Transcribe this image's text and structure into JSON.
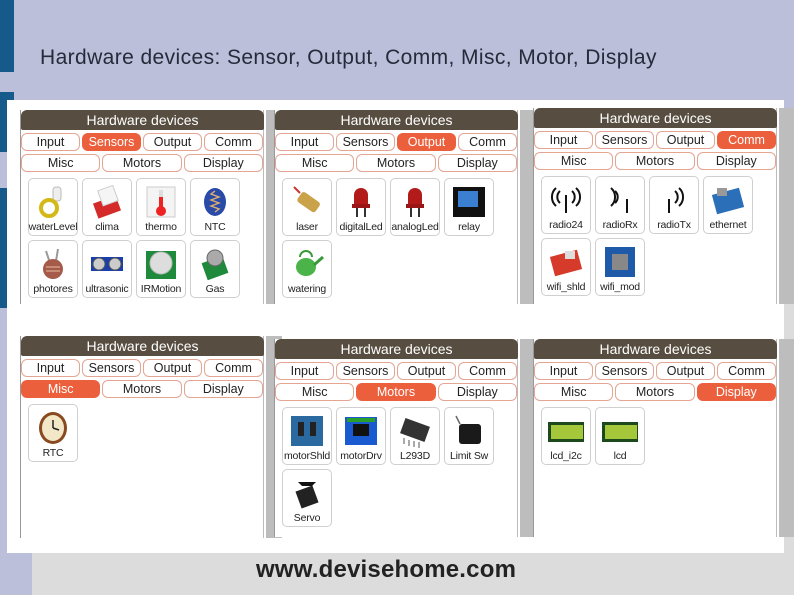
{
  "slide": {
    "title": "Hardware devices: Sensor, Output, Comm, Misc, Motor, Display",
    "footer": "www.devisehome.com"
  },
  "panel_header": "Hardware devices",
  "tabs_row1": [
    "Input",
    "Sensors",
    "Output",
    "Comm"
  ],
  "tabs_row2": [
    "Misc",
    "Motors",
    "Display"
  ],
  "colors": {
    "accent": "#ec5f3d",
    "header": "#574d40",
    "tab_border": "#e4a593"
  },
  "panels": [
    {
      "id": "sensors",
      "active": "Sensors",
      "devices": [
        {
          "label": "waterLevel",
          "icon": "water-level-sensor-icon"
        },
        {
          "label": "clima",
          "icon": "climate-sensor-icon"
        },
        {
          "label": "thermo",
          "icon": "thermometer-icon"
        },
        {
          "label": "NTC",
          "icon": "ntc-thermistor-icon"
        },
        {
          "label": "photores",
          "icon": "photoresistor-icon"
        },
        {
          "label": "ultrasonic",
          "icon": "ultrasonic-sensor-icon"
        },
        {
          "label": "IRMotion",
          "icon": "pir-motion-sensor-icon"
        },
        {
          "label": "Gas",
          "icon": "gas-sensor-icon"
        }
      ]
    },
    {
      "id": "output",
      "active": "Output",
      "devices": [
        {
          "label": "laser",
          "icon": "laser-icon"
        },
        {
          "label": "digitalLed",
          "icon": "led-icon"
        },
        {
          "label": "analogLed",
          "icon": "led-icon"
        },
        {
          "label": "relay",
          "icon": "relay-icon"
        },
        {
          "label": "watering",
          "icon": "watering-can-icon"
        }
      ]
    },
    {
      "id": "comm",
      "active": "Comm",
      "devices": [
        {
          "label": "radio24",
          "icon": "radio-antenna-icon"
        },
        {
          "label": "radioRx",
          "icon": "radio-receive-icon"
        },
        {
          "label": "radioTx",
          "icon": "radio-transmit-icon"
        },
        {
          "label": "ethernet",
          "icon": "ethernet-shield-icon"
        },
        {
          "label": "wifi_shld",
          "icon": "wifi-shield-icon"
        },
        {
          "label": "wifi_mod",
          "icon": "wifi-module-icon"
        }
      ]
    },
    {
      "id": "misc",
      "active": "Misc",
      "devices": [
        {
          "label": "RTC",
          "icon": "clock-icon"
        }
      ]
    },
    {
      "id": "motors",
      "active": "Motors",
      "devices": [
        {
          "label": "motorShld",
          "icon": "motor-shield-icon"
        },
        {
          "label": "motorDrv",
          "icon": "motor-driver-icon"
        },
        {
          "label": "L293D",
          "icon": "ic-chip-icon"
        },
        {
          "label": "Limit Sw",
          "icon": "limit-switch-icon"
        },
        {
          "label": "Servo",
          "icon": "servo-icon"
        }
      ]
    },
    {
      "id": "display",
      "active": "Display",
      "devices": [
        {
          "label": "lcd_i2c",
          "icon": "lcd-icon"
        },
        {
          "label": "lcd",
          "icon": "lcd-icon"
        }
      ]
    }
  ]
}
